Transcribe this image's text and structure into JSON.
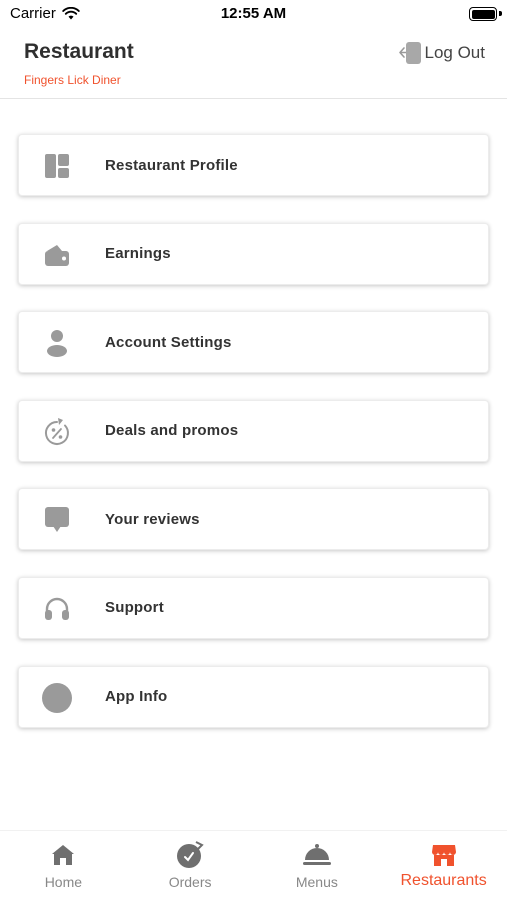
{
  "status_bar": {
    "carrier": "Carrier",
    "time": "12:55 AM"
  },
  "header": {
    "title": "Restaurant",
    "subtitle": "Fingers Lick Diner",
    "logout_label": "Log Out"
  },
  "menu": {
    "items": [
      {
        "label": "Restaurant Profile",
        "icon": "dashboard-icon"
      },
      {
        "label": "Earnings",
        "icon": "wallet-icon"
      },
      {
        "label": "Account Settings",
        "icon": "person-icon"
      },
      {
        "label": "Deals and promos",
        "icon": "discount-icon"
      },
      {
        "label": "Your reviews",
        "icon": "chat-bubble-icon"
      },
      {
        "label": "Support",
        "icon": "headphones-icon"
      },
      {
        "label": "App Info",
        "icon": "info-circle-icon"
      }
    ]
  },
  "tabbar": {
    "tabs": [
      {
        "label": "Home",
        "icon": "home-icon"
      },
      {
        "label": "Orders",
        "icon": "orders-icon"
      },
      {
        "label": "Menus",
        "icon": "cloche-icon"
      },
      {
        "label": "Restaurants",
        "icon": "store-icon"
      }
    ],
    "active": "Restaurants"
  },
  "colors": {
    "accent": "#f0522d",
    "icon_gray": "#9a9a9a",
    "text": "#333333"
  }
}
